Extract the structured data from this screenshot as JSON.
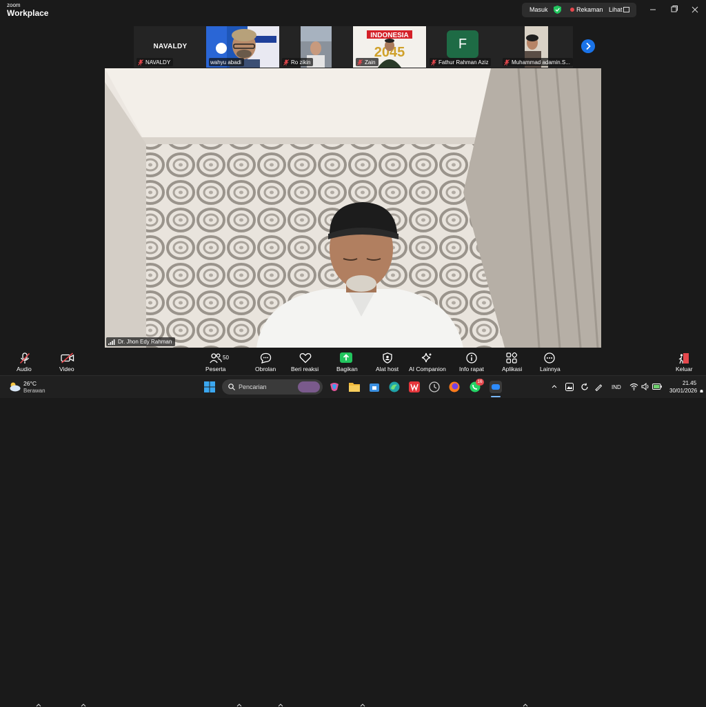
{
  "app": {
    "logo_line1": "zoom",
    "logo_line2": "Workplace"
  },
  "titlebar": {
    "sign_in": "Masuk",
    "recording": "Rekaman",
    "view": "Lihat"
  },
  "thumbnails": [
    {
      "name": "NAVALDY",
      "display": "NAVALDY"
    },
    {
      "name": "wahyu abadi"
    },
    {
      "name": "Ro zikin"
    },
    {
      "name": "Zain",
      "overlay_title": "INDONESIA",
      "overlay_year": "2045"
    },
    {
      "name": "Fathur Rahman Aziz",
      "avatar_letter": "F"
    },
    {
      "name": "Muhammad adamin.S..."
    }
  ],
  "main_video": {
    "speaker": "Dr. Jhon Edy Rahman"
  },
  "toolbar": {
    "audio": "Audio",
    "video": "Video",
    "participants": "Peserta",
    "participants_count": "50",
    "chat": "Obrolan",
    "reactions": "Beri reaksi",
    "share": "Bagikan",
    "host_tools": "Alat host",
    "ai_companion": "AI Companion",
    "meeting_info": "Info rapat",
    "apps": "Aplikasi",
    "more": "Lainnya",
    "leave": "Keluar"
  },
  "taskbar": {
    "weather_temp": "26°C",
    "weather_desc": "Berawan",
    "search_placeholder": "Pencarian",
    "whatsapp_badge": "16",
    "language": "IND",
    "time": "21.45",
    "date": "30/01/2026"
  },
  "colors": {
    "accent_blue": "#1a73e8",
    "share_green": "#22c55e",
    "leave_red": "#e5484d",
    "muted_red": "#e5484d"
  }
}
